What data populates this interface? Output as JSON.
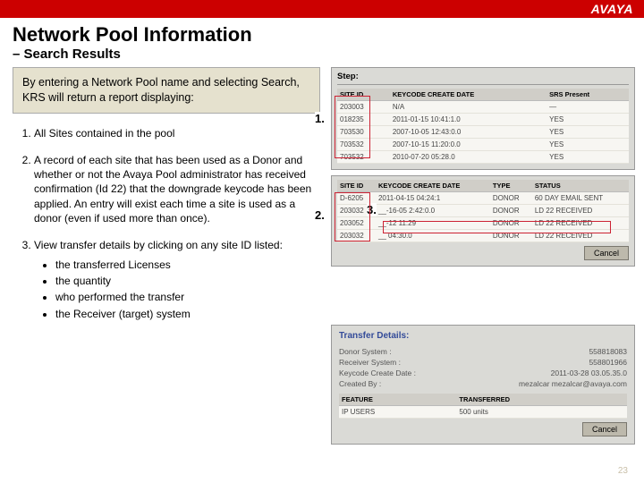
{
  "brand": "AVAYA",
  "title": "Network Pool Information",
  "subtitle": "– Search Results",
  "intro": "By entering a Network Pool name and selecting Search, KRS will return a report displaying:",
  "markers": {
    "m1": "1.",
    "m2": "2.",
    "m3": "3."
  },
  "list1": "All Sites contained in the pool",
  "list2": "A record of each site that has been used as a Donor and whether or not the Avaya Pool administrator has received confirmation (Id 22) that the downgrade keycode has been applied. An entry will exist each time a site is used as a donor (even if used more than once).",
  "list3": "View transfer details by clicking on any site ID listed:",
  "bullets": [
    "the transferred Licenses",
    "the quantity",
    "who performed the transfer",
    "the Receiver (target) system"
  ],
  "step_label": "Step:",
  "cancel": "Cancel",
  "table1": {
    "headers": [
      "SITE ID",
      "KEYCODE CREATE DATE",
      "SRS Present"
    ],
    "rows": [
      [
        "203003",
        "N/A",
        "—"
      ],
      [
        "018235",
        "2011-01-15 10:41:1.0",
        "YES"
      ],
      [
        "703530",
        "2007-10-05 12:43:0.0",
        "YES"
      ],
      [
        "703532",
        "2007-10-15 11:20:0.0",
        "YES"
      ],
      [
        "703532",
        "2010-07-20 05:28.0",
        "YES"
      ]
    ]
  },
  "table2": {
    "headers": [
      "SITE ID",
      "KEYCODE CREATE DATE",
      "TYPE",
      "STATUS"
    ],
    "rows": [
      [
        "D-6205",
        "2011-04-15 04:24:1",
        "DONOR",
        "60 DAY EMAIL SENT"
      ],
      [
        "203032",
        "__-16-05 2:42:0.0",
        "DONOR",
        "LD 22 RECEIVED"
      ],
      [
        "203052",
        "__-12 11:29",
        "DONOR",
        "LD 22 RECEIVED"
      ],
      [
        "203032",
        "__ 04:30.0",
        "DONOR",
        "LD 22 RECEIVED"
      ]
    ]
  },
  "transfer": {
    "title": "Transfer Details:",
    "rows": [
      [
        "Donor System :",
        "558818083"
      ],
      [
        "Receiver System :",
        "558801966"
      ],
      [
        "Keycode Create Date :",
        "2011-03-28 03.05.35.0"
      ],
      [
        "Created By :",
        "mezalcar  mezalcar@avaya.com"
      ]
    ],
    "feat_headers": [
      "FEATURE",
      "TRANSFERRED"
    ],
    "feat_rows": [
      [
        "IP USERS",
        "500 units"
      ]
    ]
  },
  "page_number": "23"
}
